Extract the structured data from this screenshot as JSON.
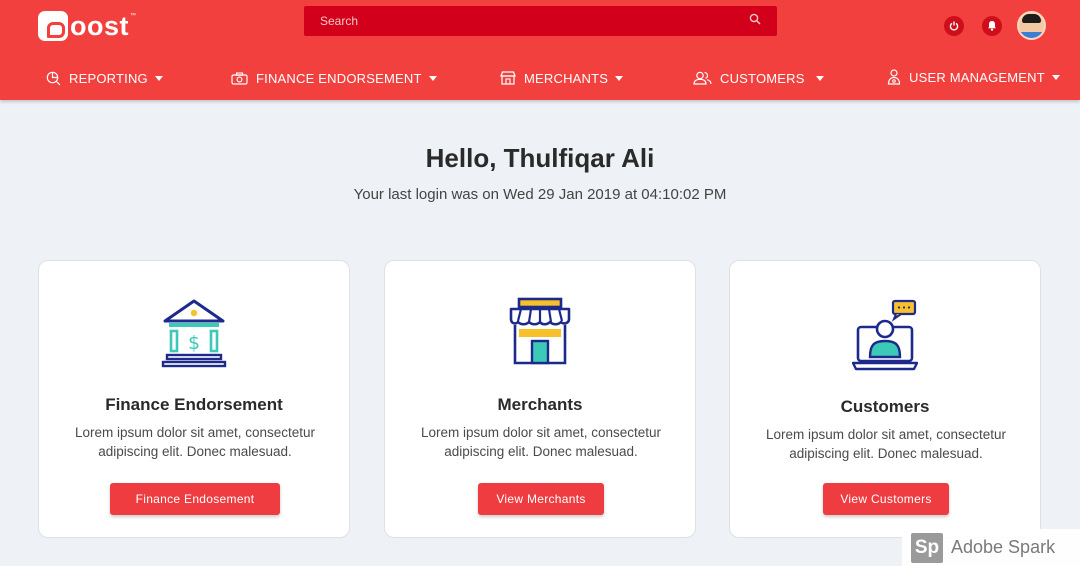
{
  "header": {
    "logo_text": "oost",
    "logo_tm": "™",
    "search": {
      "placeholder": "Search"
    }
  },
  "nav": [
    {
      "label": "REPORTING",
      "icon": "reporting-icon"
    },
    {
      "label": "FINANCE ENDORSEMENT",
      "icon": "camera-icon"
    },
    {
      "label": "MERCHANTS",
      "icon": "store-icon"
    },
    {
      "label": "CUSTOMERS",
      "icon": "users-icon"
    },
    {
      "label": "USER MANAGEMENT",
      "icon": "user-settings-icon"
    }
  ],
  "main": {
    "greeting": "Hello, Thulfiqar Ali",
    "last_login": "Your last login was on Wed 29 Jan 2019 at 04:10:02 PM"
  },
  "cards": [
    {
      "title": "Finance Endorsement",
      "description": "Lorem ipsum dolor sit amet, consectetur adipiscing elit. Donec malesuad.",
      "button": "Finance Endosement",
      "icon": "bank-icon"
    },
    {
      "title": "Merchants",
      "description": "Lorem ipsum dolor sit amet, consectetur adipiscing elit. Donec malesuad.",
      "button": "View Merchants",
      "icon": "shop-icon"
    },
    {
      "title": "Customers",
      "description": "Lorem ipsum dolor sit amet, consectetur adipiscing elit. Donec malesuad.",
      "button": "View Customers",
      "icon": "customer-laptop-icon"
    }
  ],
  "watermark": {
    "logo": "Sp",
    "text": "Adobe Spark"
  },
  "colors": {
    "brand": "#f2403f",
    "search_bg": "#d2001a",
    "button": "#ef3c40",
    "page_bg": "#eef1f5",
    "icon_navy": "#1d2a8c",
    "icon_teal": "#3cc9b8",
    "icon_yellow": "#f7c12b"
  }
}
